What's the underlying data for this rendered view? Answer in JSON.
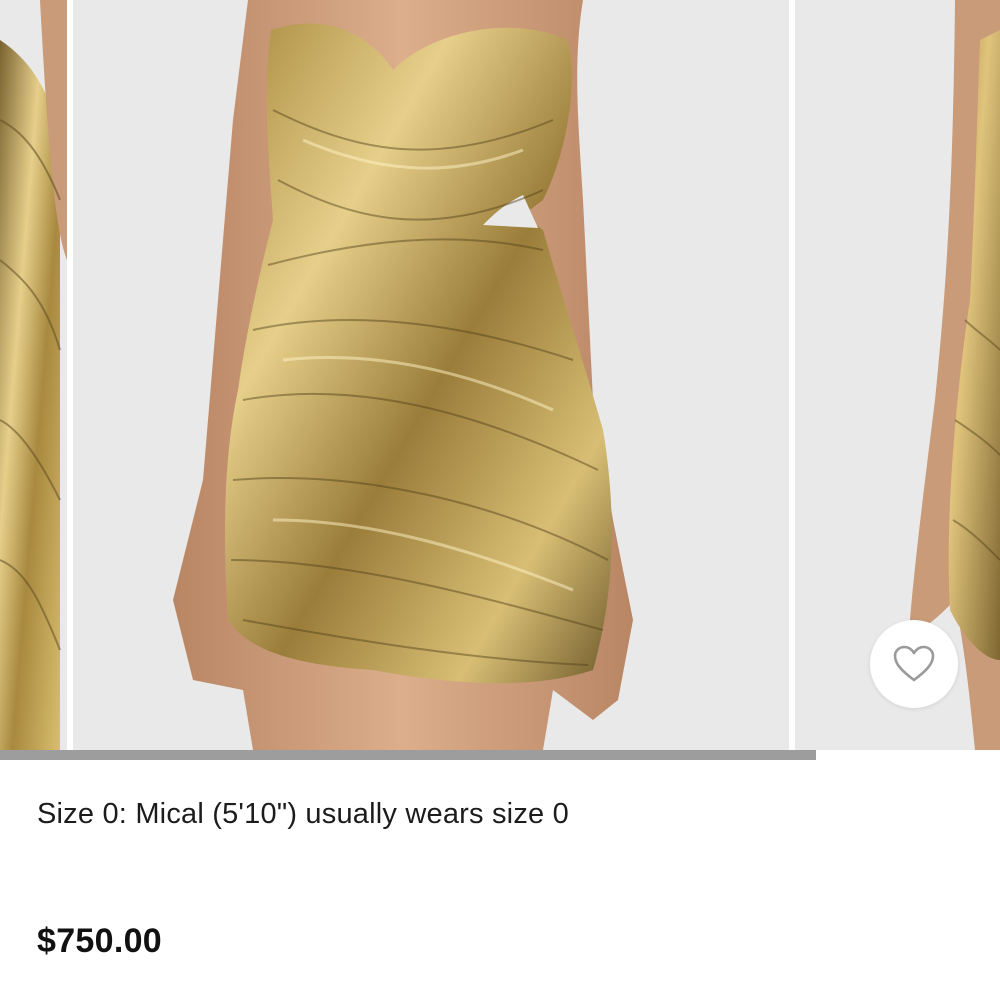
{
  "gallery": {
    "slide_count": 3,
    "current_slide": 2,
    "progress_fraction": 0.816,
    "colors": {
      "backdrop": "#e9e9ea",
      "gold_light": "#e6cf8a",
      "gold_mid": "#b8994f",
      "gold_dark": "#6f5a2b",
      "skin": "#d7a784",
      "progress": "#9d9d9d"
    },
    "favorite_icon": "heart-outline-icon"
  },
  "product": {
    "size_note": "Size 0: Mical (5'10\") usually wears size 0",
    "price": "$750.00"
  }
}
